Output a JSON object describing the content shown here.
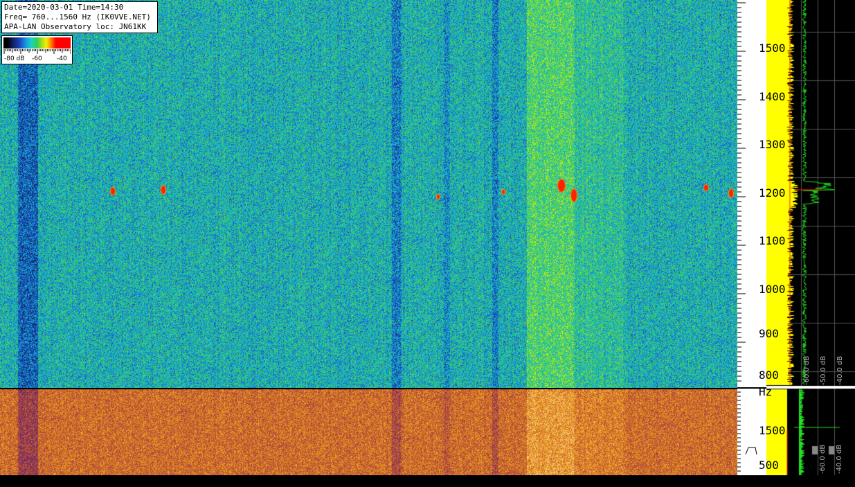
{
  "info": {
    "line1": "Date=2020-03-01 Time=14:30",
    "line2": "Freq= 760...1560 Hz (IK0VVE.NET)",
    "line3": "APA-LAN Observatory loc: JN61KK"
  },
  "colorbar": {
    "labels": [
      "-80 dB",
      "-60",
      "-40"
    ],
    "colors": [
      "#000000",
      "#1a40c0",
      "#20d0c0",
      "#30d050",
      "#f0f000",
      "#ff9000",
      "#ff0000"
    ]
  },
  "frequency_axis": {
    "unit": "Hz",
    "ticks": [
      "1500",
      "1400",
      "1300",
      "1200",
      "1100",
      "1000",
      "900",
      "800"
    ],
    "lower_ticks": [
      "1500",
      "500"
    ]
  },
  "spectrum_panel": {
    "db_labels": [
      "-60.0 dB",
      "-50.0 dB",
      "-40.0 dB"
    ],
    "lower_db_labels": [
      "-60.0 dB",
      "-40.0 dB"
    ]
  },
  "colors": {
    "waterfall_low": "#1e3f9a",
    "waterfall_mid": "#20b0b0",
    "waterfall_high": "#50d040",
    "signal": "#ff2000",
    "spectrum_average": "#ffff00",
    "spectrum_peak": "#20e020",
    "lower_panel_bg": "#c07818"
  }
}
